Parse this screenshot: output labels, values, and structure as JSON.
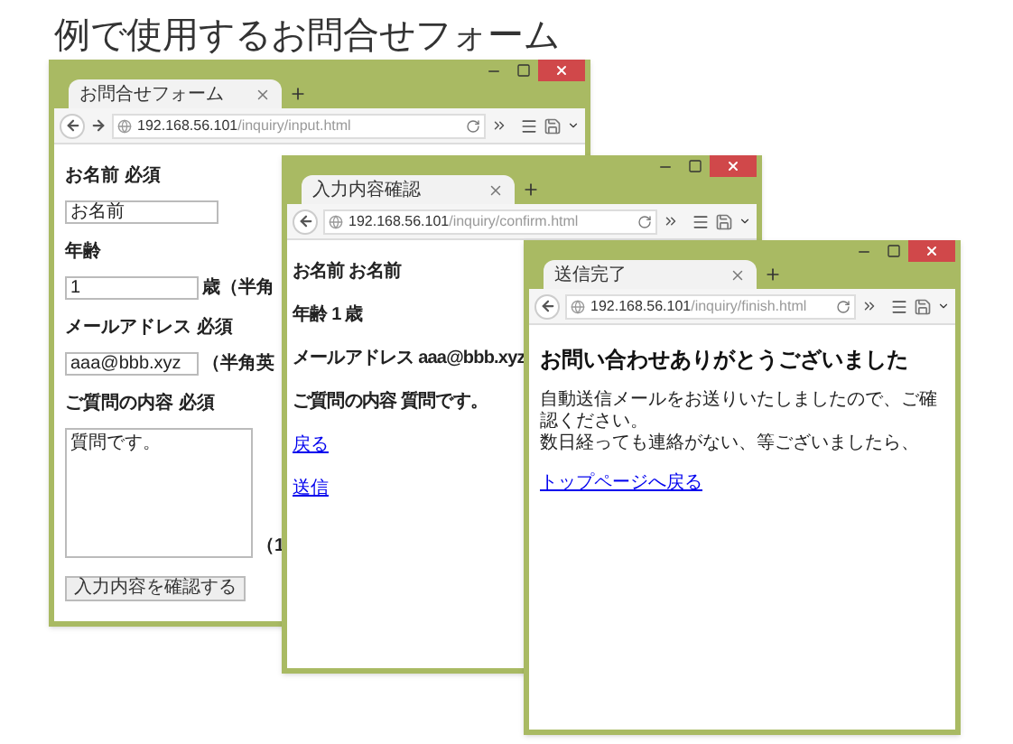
{
  "heading": "例で使用するお問合せフォーム",
  "windows": [
    {
      "kind": "form",
      "tab": "お問合せフォーム",
      "forward": true,
      "url_host": "192.168.56.101",
      "url_path": "/inquiry/input.html",
      "fields": [
        {
          "kind": "input",
          "label": "お名前 必須",
          "value": "お名前"
        },
        {
          "kind": "input",
          "label": "年齢",
          "value": "1",
          "suffix": "歳（半角"
        },
        {
          "kind": "input",
          "label": "メールアドレス 必須",
          "value": "aaa@bbb.xyz",
          "suffix": "（半角英"
        },
        {
          "kind": "textarea",
          "label": "ご質問の内容 必須",
          "value": "質問です。",
          "suffix": "（1"
        }
      ],
      "button": "入力内容を確認する"
    },
    {
      "kind": "confirm",
      "tab": "入力内容確認",
      "forward": false,
      "url_host": "192.168.56.101",
      "url_path": "/inquiry/confirm.html",
      "lines": [
        "お名前 お名前",
        "年齢 1 歳",
        "メールアドレス aaa@bbb.xyz",
        "ご質問の内容 質問です。"
      ],
      "links": [
        "戻る",
        "送信"
      ]
    },
    {
      "kind": "finish",
      "tab": "送信完了",
      "forward": false,
      "url_host": "192.168.56.101",
      "url_path": "/inquiry/finish.html",
      "title": "お問い合わせありがとうございました",
      "paragraph": [
        "自動送信メールをお送りいたしましたので、ご確認ください。",
        "数日経っても連絡がない、等ございましたら、"
      ],
      "link": "トップページへ戻る"
    }
  ]
}
